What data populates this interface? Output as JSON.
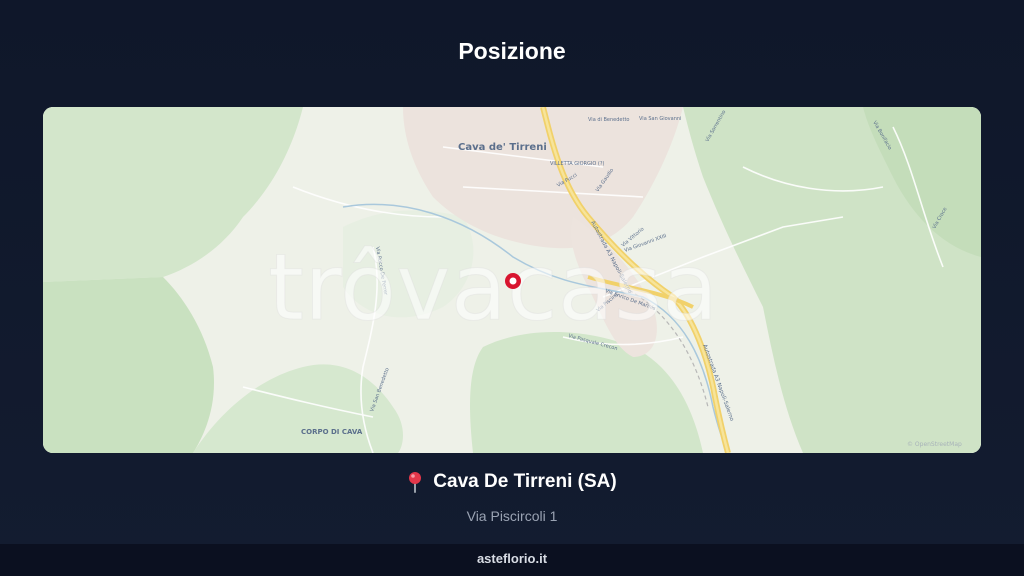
{
  "page": {
    "title": "Posizione"
  },
  "map": {
    "labels": {
      "city": "Cava de' Tirreni",
      "frazione": "CORPO DI CAVA",
      "villetta": "VILLETTA GIORGIO (?)",
      "via_san_benedetto": "Via di Benedetto",
      "via_san_giovanni": "Via San Giovanni",
      "via_sorrentino": "Via Sorrentino",
      "via_pucci": "Via Pucci",
      "via_gaudio": "Via Gaudio",
      "via_vittorio": "Via Vittorio",
      "via_sorrento_2": "Via Sorrento",
      "via_giovanni_xxiii": "Via Giovanni XXIII",
      "via_pasquale_crecon": "Via Pasquale Crecon",
      "via_enrico_de_marinis": "Via Enrico De Marinis",
      "via_piscina": "Via Piscina",
      "via_san_benedetto_2": "Via San Benedetto",
      "autostrada_1": "Autostrada A3 Napoli-Salerno",
      "autostrada_2": "Autostrada A3 Napoli-Salerno",
      "via_rocco_de_ferrer": "Via Rocco De Ferrer",
      "via_croce": "Via Croce",
      "via_bonifacio": "Via Bonifacio"
    },
    "watermark": "trôvacasa",
    "attribution": "© OpenStreetMap",
    "marker_icon": "map-marker-icon"
  },
  "location": {
    "pin_icon": "round-pushpin-icon",
    "title": "Cava De Tirreni (SA)",
    "address": "Via Piscircoli 1"
  },
  "footer": {
    "site": "asteflorio.it"
  },
  "colors": {
    "background": "#111a2d",
    "map_land": "#eef0e7",
    "map_green": "#cfe4c6",
    "map_urban": "#ebe2dc",
    "highway": "#f3d36a",
    "marker": "#d8152f"
  }
}
